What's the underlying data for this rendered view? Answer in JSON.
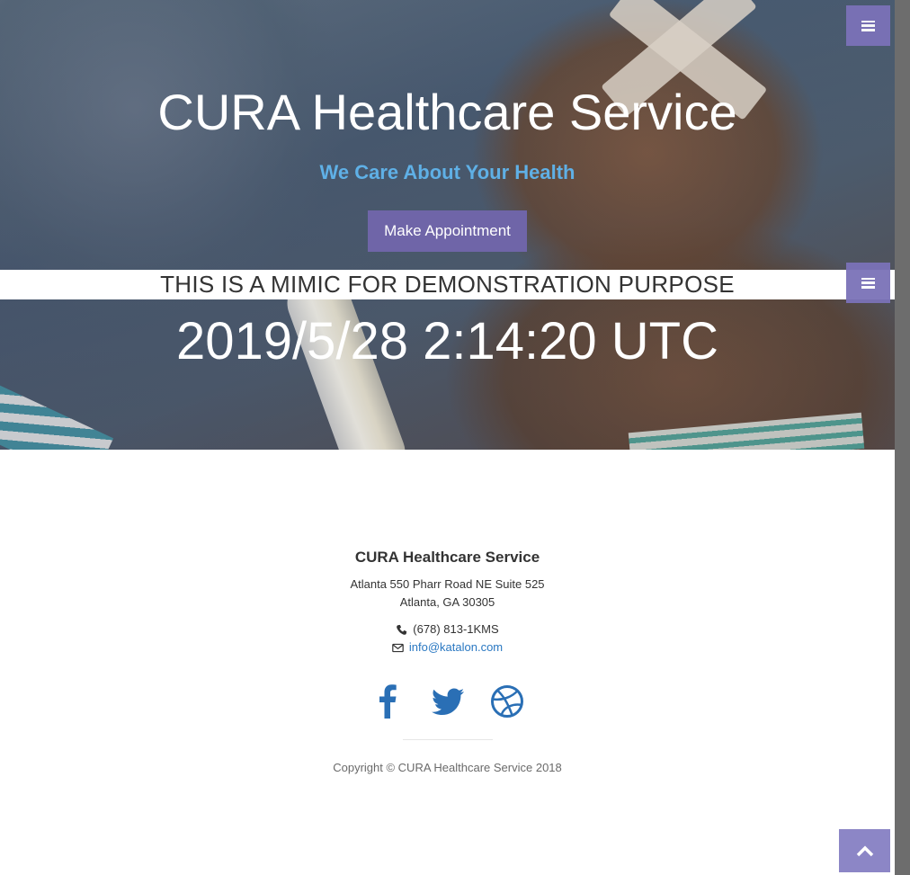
{
  "hero": {
    "title": "CURA Healthcare Service",
    "subtitle": "We Care About Your Health",
    "appointment_button": "Make Appointment"
  },
  "banner": {
    "demo_text": "THIS IS A MIMIC FOR DEMONSTRATION PURPOSE",
    "clock": "2019/5/28 2:14:20 UTC"
  },
  "footer": {
    "title": "CURA Healthcare Service",
    "address_line1": "Atlanta 550 Pharr Road NE Suite 525",
    "address_line2": "Atlanta, GA 30305",
    "phone": "(678) 813-1KMS",
    "email": "info@katalon.com",
    "social": [
      "facebook-icon",
      "twitter-icon",
      "dribbble-icon"
    ],
    "copyright": "Copyright © CURA Healthcare Service 2018"
  },
  "colors": {
    "accent": "#6f65a8",
    "menu_toggle": "#7b72b8",
    "subtitle": "#5fb0e6",
    "link": "#2a78c2",
    "social": "#2a6fb5"
  },
  "icons": {
    "menu": "bars-icon",
    "scroll_top": "chevron-up-icon",
    "phone": "phone-icon",
    "email": "envelope-icon"
  }
}
